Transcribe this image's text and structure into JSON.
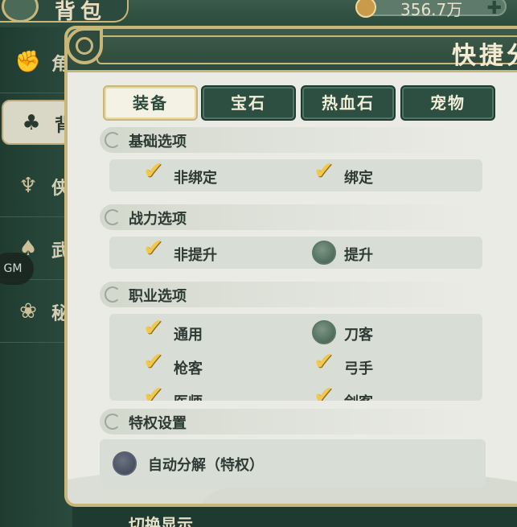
{
  "background": {
    "title": "背包",
    "currency": "356.7万",
    "sidebar": [
      {
        "label": "角",
        "icon": "fist-icon",
        "glyph": "✊"
      },
      {
        "label": "背",
        "icon": "bag-icon",
        "glyph": "♣"
      },
      {
        "label": "侠",
        "icon": "fan-icon",
        "glyph": "♆"
      },
      {
        "label": "武",
        "icon": "wings-icon",
        "glyph": "♠"
      },
      {
        "label": "秘",
        "icon": "lotus-icon",
        "glyph": "❀"
      }
    ],
    "gm_label": "GM",
    "bottom_text": "切换显示"
  },
  "dialog": {
    "title": "快捷分解",
    "tabs": [
      {
        "label": "装备",
        "active": true
      },
      {
        "label": "宝石",
        "active": false
      },
      {
        "label": "热血石",
        "active": false
      },
      {
        "label": "宠物",
        "active": false
      }
    ],
    "sections": {
      "basic": {
        "title": "基础选项",
        "options": [
          {
            "label": "非绑定",
            "checked": true
          },
          {
            "label": "绑定",
            "checked": true
          }
        ]
      },
      "power": {
        "title": "战力选项",
        "options": [
          {
            "label": "非提升",
            "checked": true
          },
          {
            "label": "提升",
            "checked": false
          }
        ]
      },
      "class": {
        "title": "职业选项",
        "options": [
          {
            "label": "通用",
            "checked": true
          },
          {
            "label": "刀客",
            "checked": false
          },
          {
            "label": "枪客",
            "checked": true
          },
          {
            "label": "弓手",
            "checked": true
          },
          {
            "label": "医师",
            "checked": true
          },
          {
            "label": "剑客",
            "checked": true
          }
        ]
      },
      "privilege": {
        "title": "特权设置",
        "option": {
          "label": "自动分解（特权）",
          "checked": false
        }
      }
    }
  }
}
